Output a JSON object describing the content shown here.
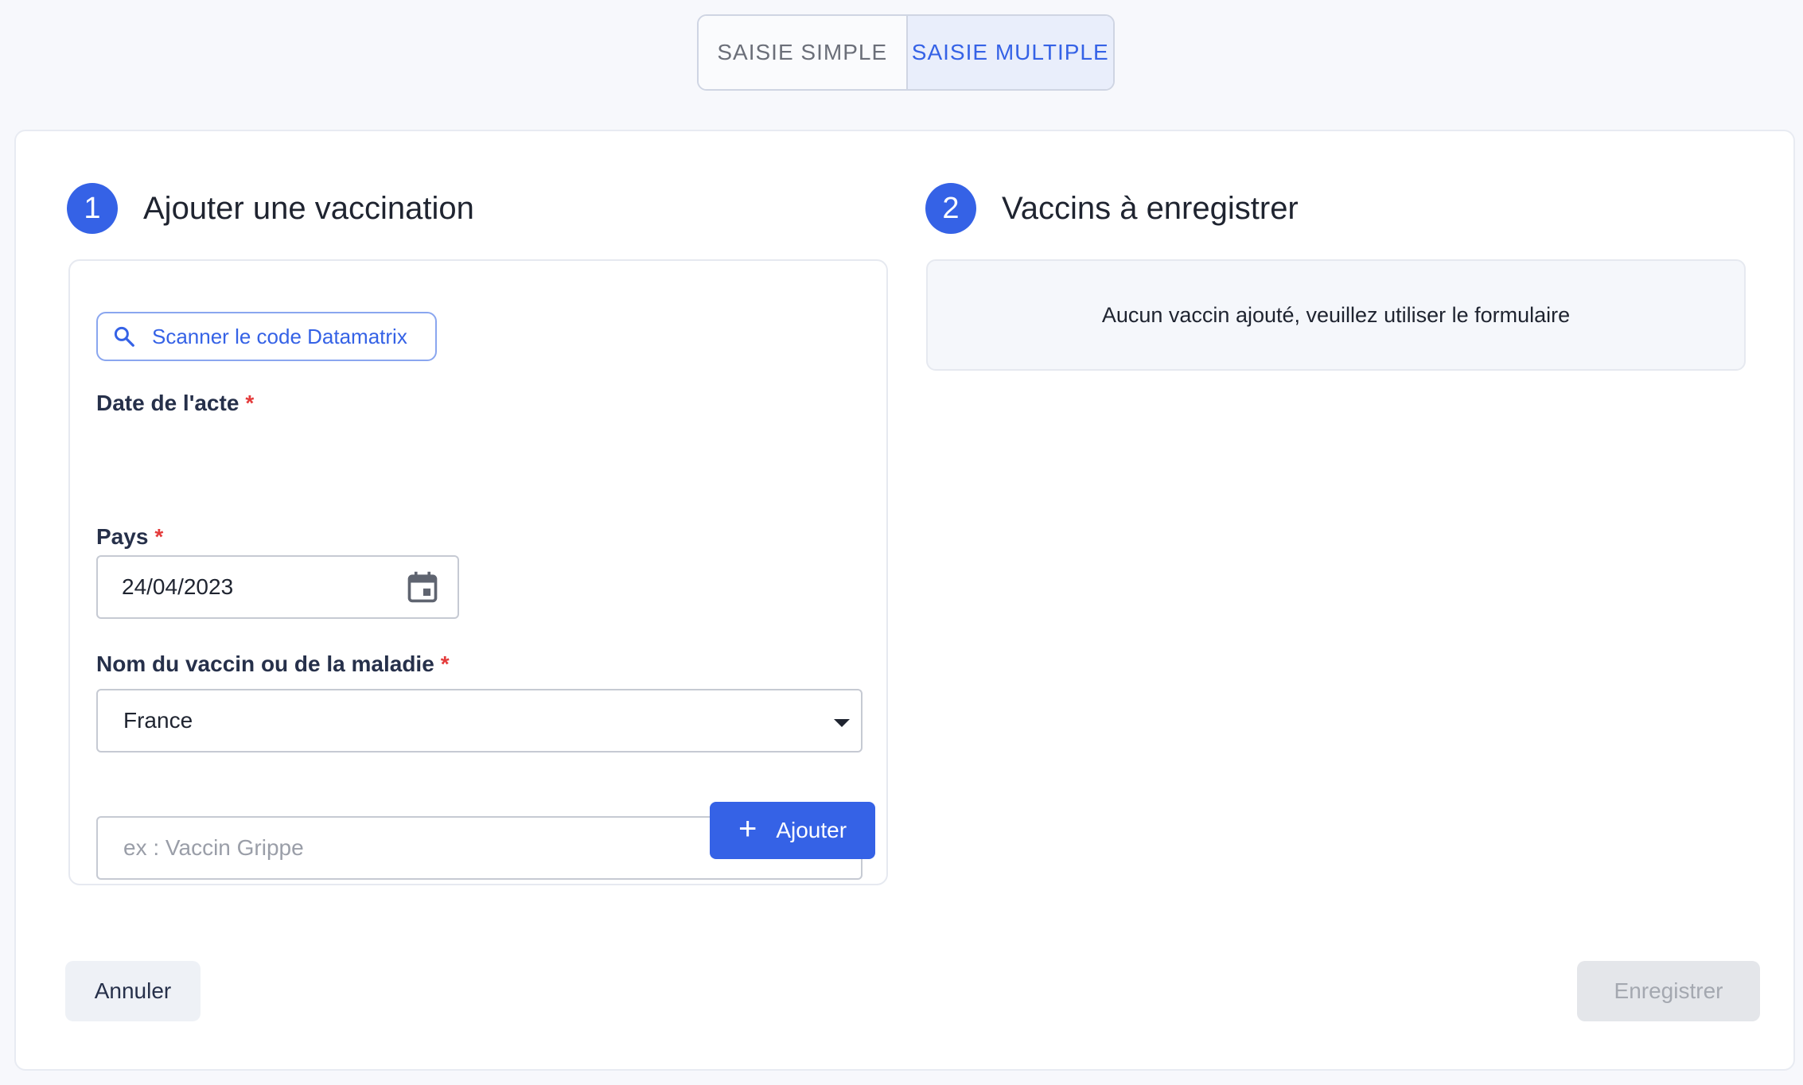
{
  "mode_toggle": {
    "simple_label": "SAISIE SIMPLE",
    "multiple_label": "SAISIE MULTIPLE",
    "active": "multiple"
  },
  "step1": {
    "number": "1",
    "title": "Ajouter une vaccination"
  },
  "step2": {
    "number": "2",
    "title": "Vaccins à enregistrer"
  },
  "form": {
    "scan_button_label": "Scanner le code Datamatrix",
    "date": {
      "label": "Date de l'acte",
      "required_mark": "*",
      "value": "24/04/2023"
    },
    "country": {
      "label": "Pays",
      "required_mark": "*",
      "value": "France"
    },
    "vaccine": {
      "label": "Nom du vaccin ou de la maladie",
      "required_mark": "*",
      "placeholder": "ex : Vaccin Grippe"
    },
    "add_button_label": "Ajouter"
  },
  "vaccines_list": {
    "empty_message": "Aucun vaccin ajouté, veuillez utiliser le formulaire"
  },
  "footer": {
    "cancel_label": "Annuler",
    "save_label": "Enregistrer"
  },
  "colors": {
    "accent": "#3562e6",
    "required": "#e43b3b"
  }
}
